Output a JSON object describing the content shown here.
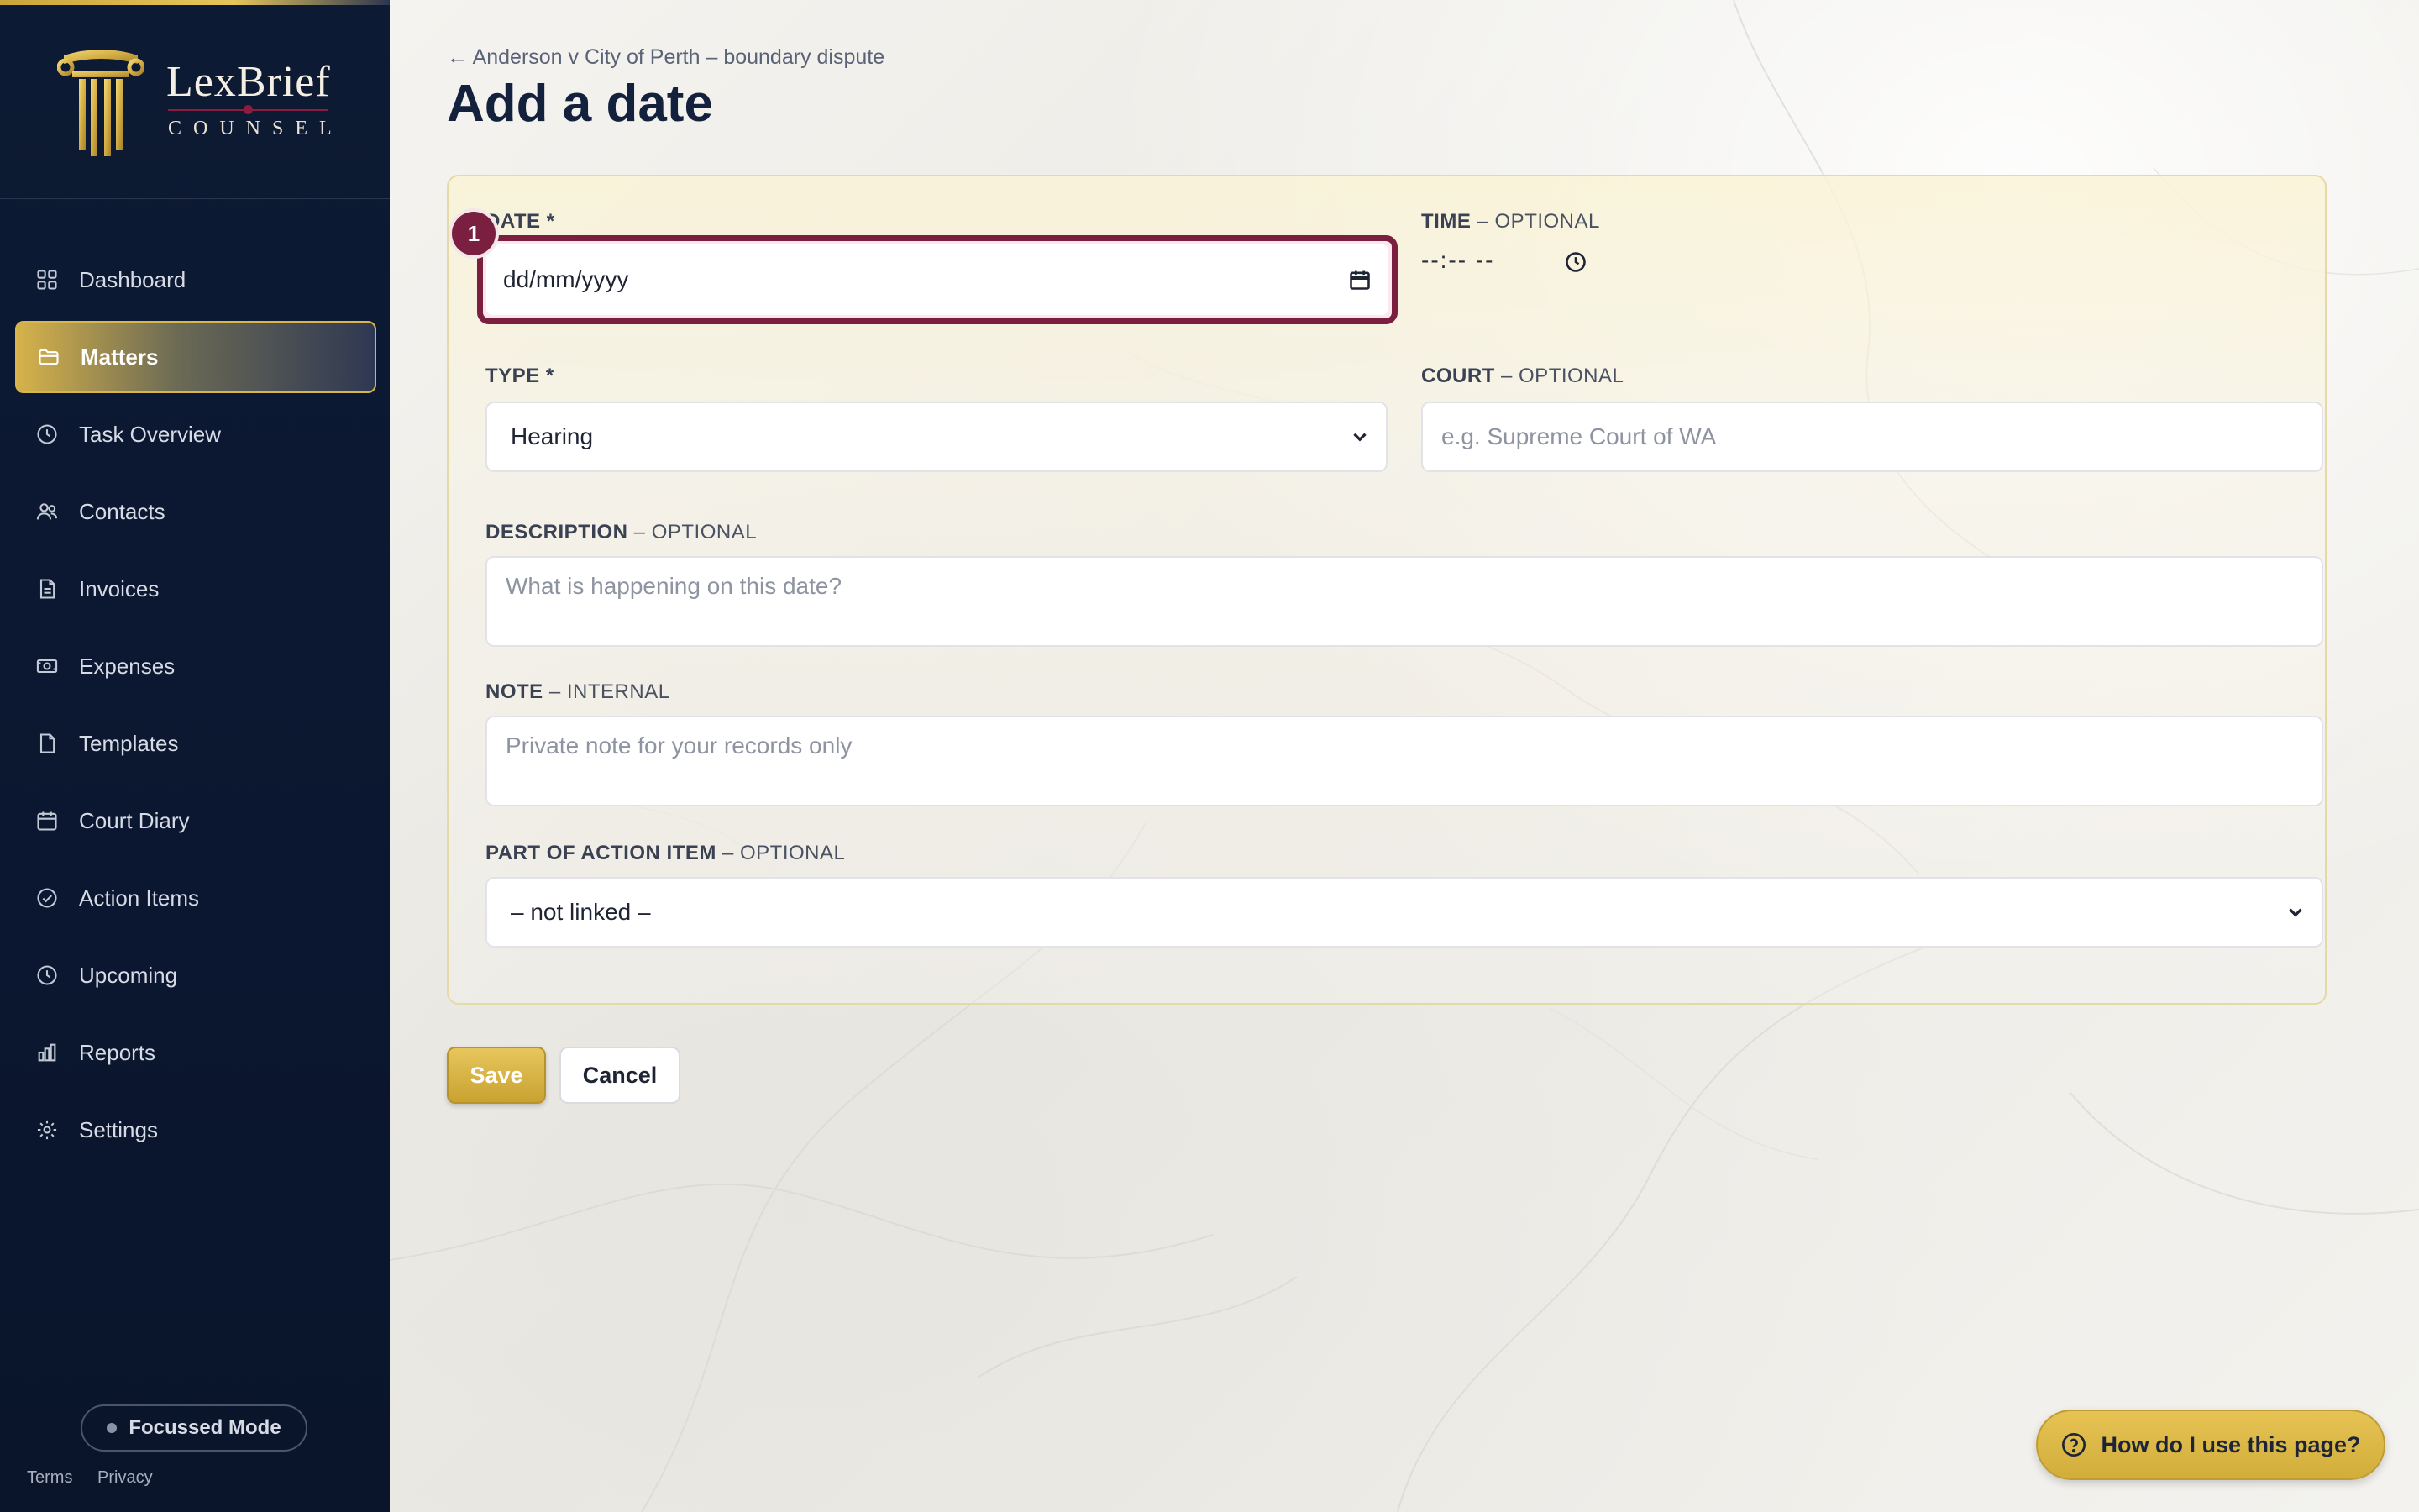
{
  "brand": {
    "name": "LexBrief",
    "tagline": "COUNSEL"
  },
  "sidebar": {
    "items": [
      {
        "label": "Dashboard",
        "icon": "grid-icon",
        "active": false
      },
      {
        "label": "Matters",
        "icon": "folder-icon",
        "active": true
      },
      {
        "label": "Task Overview",
        "icon": "clock-icon",
        "active": false
      },
      {
        "label": "Contacts",
        "icon": "users-icon",
        "active": false
      },
      {
        "label": "Invoices",
        "icon": "invoice-icon",
        "active": false
      },
      {
        "label": "Expenses",
        "icon": "cash-icon",
        "active": false
      },
      {
        "label": "Templates",
        "icon": "file-icon",
        "active": false
      },
      {
        "label": "Court Diary",
        "icon": "calendar-icon",
        "active": false
      },
      {
        "label": "Action Items",
        "icon": "check-circle-icon",
        "active": false
      },
      {
        "label": "Upcoming",
        "icon": "clock-icon",
        "active": false
      },
      {
        "label": "Reports",
        "icon": "bar-chart-icon",
        "active": false
      },
      {
        "label": "Settings",
        "icon": "gear-icon",
        "active": false
      }
    ],
    "focus_mode_label": "Focussed Mode",
    "terms_label": "Terms",
    "privacy_label": "Privacy"
  },
  "breadcrumb": "← Anderson v City of Perth – boundary dispute",
  "page_title": "Add a date",
  "form": {
    "date": {
      "label": "DATE",
      "required_mark": " *",
      "value": "dd/mm/yyyy",
      "step_badge": "1"
    },
    "time": {
      "label": "TIME",
      "suffix": " – OPTIONAL",
      "value": "--:-- --"
    },
    "type": {
      "label": "TYPE",
      "required_mark": " *",
      "value": "Hearing"
    },
    "court": {
      "label": "COURT",
      "suffix": " – OPTIONAL",
      "placeholder": "e.g. Supreme Court of WA"
    },
    "description": {
      "label": "DESCRIPTION",
      "suffix": " – OPTIONAL",
      "placeholder": "What is happening on this date?"
    },
    "note": {
      "label": "NOTE",
      "suffix": " – INTERNAL",
      "placeholder": "Private note for your records only"
    },
    "action_item": {
      "label": "PART OF ACTION ITEM",
      "suffix": " – OPTIONAL",
      "value": "– not linked –"
    }
  },
  "buttons": {
    "save": "Save",
    "cancel": "Cancel"
  },
  "help": {
    "label": "How do I use this page?"
  },
  "colors": {
    "navy": "#0d1a33",
    "gold": "#d6b24a",
    "maroon": "#7a1f3f"
  }
}
